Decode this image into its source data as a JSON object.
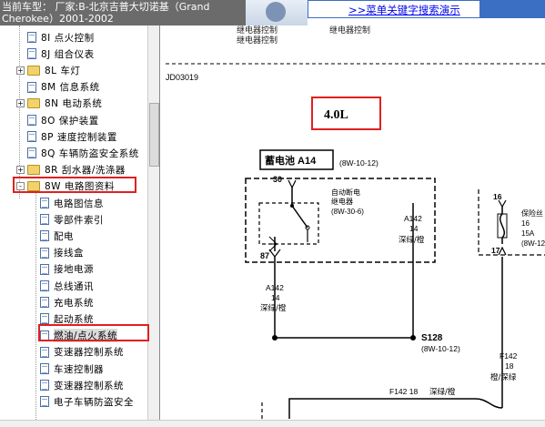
{
  "header": {
    "vehicle_line1": "当前车型： 厂家:B-北京吉普大切诺基（Grand",
    "vehicle_line2": "Cherokee）2001-2002",
    "search_link": ">>菜单关键字搜索演示"
  },
  "sidebar": {
    "items": [
      {
        "label": "8I 点火控制",
        "kind": "doc",
        "expand": ""
      },
      {
        "label": "8J 组合仪表",
        "kind": "doc",
        "expand": ""
      },
      {
        "label": "8L 车灯",
        "kind": "folder",
        "expand": "+"
      },
      {
        "label": "8M 信息系统",
        "kind": "doc",
        "expand": ""
      },
      {
        "label": "8N 电动系统",
        "kind": "folder",
        "expand": "+"
      },
      {
        "label": "8O 保护装置",
        "kind": "doc",
        "expand": ""
      },
      {
        "label": "8P 速度控制装置",
        "kind": "doc",
        "expand": ""
      },
      {
        "label": "8Q 车辆防盗安全系统",
        "kind": "doc",
        "expand": ""
      },
      {
        "label": "8R 刮水器/洗涤器",
        "kind": "folder",
        "expand": "+"
      },
      {
        "label": "8W 电路图资料",
        "kind": "folder",
        "expand": "-"
      },
      {
        "label": "电路图信息",
        "kind": "doc",
        "expand": ""
      },
      {
        "label": "零部件索引",
        "kind": "doc",
        "expand": ""
      },
      {
        "label": "配电",
        "kind": "doc",
        "expand": ""
      },
      {
        "label": "接线盒",
        "kind": "doc",
        "expand": ""
      },
      {
        "label": "接地电源",
        "kind": "doc",
        "expand": ""
      },
      {
        "label": "总线通讯",
        "kind": "doc",
        "expand": ""
      },
      {
        "label": "充电系统",
        "kind": "doc",
        "expand": ""
      },
      {
        "label": "起动系统",
        "kind": "doc",
        "expand": ""
      },
      {
        "label": "燃油/点火系统",
        "kind": "doc",
        "expand": ""
      },
      {
        "label": "变速器控制系统",
        "kind": "doc",
        "expand": ""
      },
      {
        "label": "车速控制器",
        "kind": "doc",
        "expand": ""
      },
      {
        "label": "变速器控制系统",
        "kind": "doc",
        "expand": ""
      },
      {
        "label": "电子车辆防盗安全",
        "kind": "doc",
        "expand": ""
      }
    ]
  },
  "diagram": {
    "top_label_1": "继电器控制",
    "top_label_2": "继电器控制",
    "top_label_3": "继电器控制",
    "doc_code": "JD03019",
    "engine": "4.0L",
    "battery_label": "蓄电池 A14",
    "battery_ref": "(8W-10-12)",
    "pin_30": "30",
    "pin_87": "87",
    "relay_l1": "自动断电",
    "relay_l2": "继电器",
    "relay_ref": "(8W-30-6)",
    "wire_mid_code": "A142",
    "wire_mid_gauge": "14",
    "wire_mid_color": "深绿/橙",
    "wire_left_code": "A142",
    "wire_left_gauge": "14",
    "wire_left_color": "深绿/橙",
    "splice": "S128",
    "splice_ref": "(8W-10-12)",
    "pin_16a": "16",
    "pin_16b": "16",
    "fuse_l1": "保险丝",
    "fuse_amp": "15A",
    "fuse_ref": "(8W-12-",
    "pin_17": "17",
    "wire_right_code": "F142",
    "wire_right_gauge": "18",
    "wire_right_color": "橙/深绿",
    "bottom_wire_code": "F142 18",
    "bottom_wire_color": "深绿/橙"
  }
}
